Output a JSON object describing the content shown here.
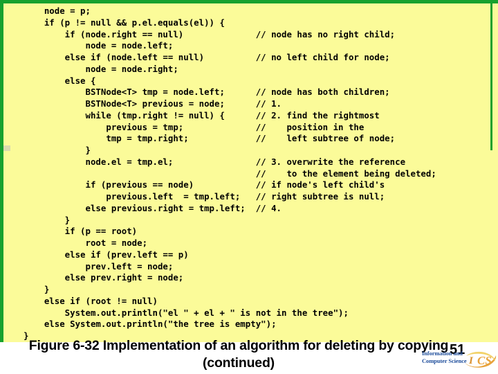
{
  "slide": {
    "background_color": "#ffffff",
    "panel_color": "#fbfb99",
    "border_color": "#17a12e",
    "accent_color": "#1f4e9c"
  },
  "code": {
    "language": "java",
    "text": "    node = p;\n    if (p != null && p.el.equals(el)) {\n        if (node.right == null)              // node has no right child;\n            node = node.left;\n        else if (node.left == null)          // no left child for node;\n            node = node.right;\n        else {\n            BSTNode<T> tmp = node.left;      // node has both children;\n            BSTNode<T> previous = node;      // 1.\n            while (tmp.right != null) {      // 2. find the rightmost\n                previous = tmp;              //    position in the\n                tmp = tmp.right;             //    left subtree of node;\n            }\n            node.el = tmp.el;                // 3. overwrite the reference\n                                             //    to the element being deleted;\n            if (previous == node)            // if node's left child's\n                previous.left  = tmp.left;   // right subtree is null;\n            else previous.right = tmp.left;  // 4.\n        }\n        if (p == root)\n            root = node;\n        else if (prev.left == p)\n            prev.left = node;\n        else prev.right = node;\n    }\n    else if (root != null)\n        System.out.println(\"el \" + el + \" is not in the tree\");\n    else System.out.println(\"the tree is empty\");\n}"
  },
  "caption": {
    "line1": "Figure 6-32 Implementation of an algorithm for deleting by copying",
    "line2": "(continued)"
  },
  "page_number": "51",
  "logo": {
    "line1": "Information and",
    "line2": "Computer Science",
    "mark_text": "ICS"
  }
}
